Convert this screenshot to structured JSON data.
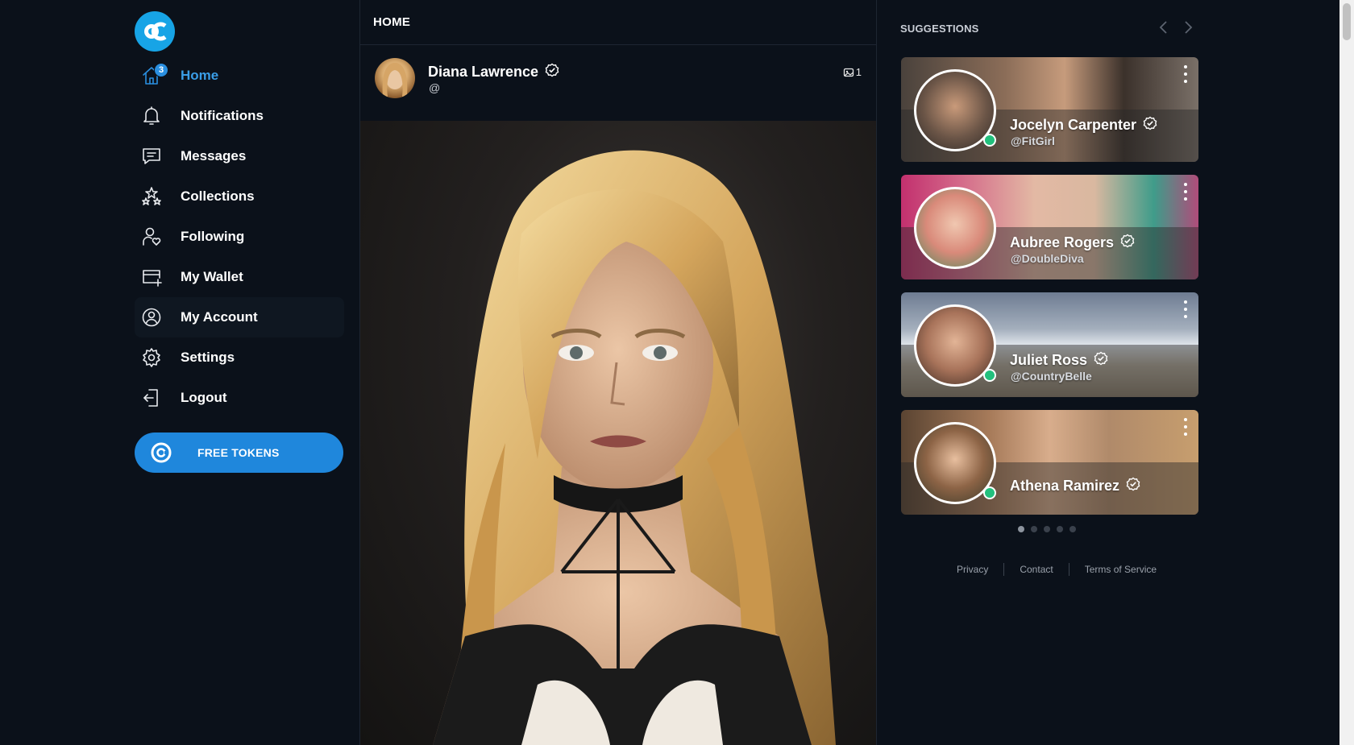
{
  "nav": {
    "items": [
      {
        "label": "Home",
        "icon": "home-icon",
        "badge": "3",
        "active": true
      },
      {
        "label": "Notifications",
        "icon": "bell-icon"
      },
      {
        "label": "Messages",
        "icon": "message-icon"
      },
      {
        "label": "Collections",
        "icon": "stars-icon"
      },
      {
        "label": "Following",
        "icon": "user-heart-icon"
      },
      {
        "label": "My Wallet",
        "icon": "card-plus-icon"
      },
      {
        "label": "My Account",
        "icon": "user-circle-icon"
      },
      {
        "label": "Settings",
        "icon": "gear-icon"
      },
      {
        "label": "Logout",
        "icon": "logout-icon"
      }
    ],
    "free_tokens_label": "FREE TOKENS"
  },
  "feed": {
    "title": "HOME",
    "post": {
      "author_name": "Diana Lawrence",
      "author_handle": "@",
      "media_count": "1"
    }
  },
  "suggestions": {
    "title": "SUGGESTIONS",
    "cards": [
      {
        "name": "Jocelyn Carpenter",
        "handle": "@FitGirl"
      },
      {
        "name": "Aubree Rogers",
        "handle": "@DoubleDiva"
      },
      {
        "name": "Juliet Ross",
        "handle": "@CountryBelle"
      },
      {
        "name": "Athena Ramirez",
        "handle": ""
      }
    ],
    "page_count": 5,
    "active_page": 1
  },
  "footer": {
    "privacy": "Privacy",
    "contact": "Contact",
    "terms": "Terms of Service"
  },
  "colors": {
    "background": "#0b111a",
    "accent": "#1f87dc",
    "online": "#22c07d"
  }
}
